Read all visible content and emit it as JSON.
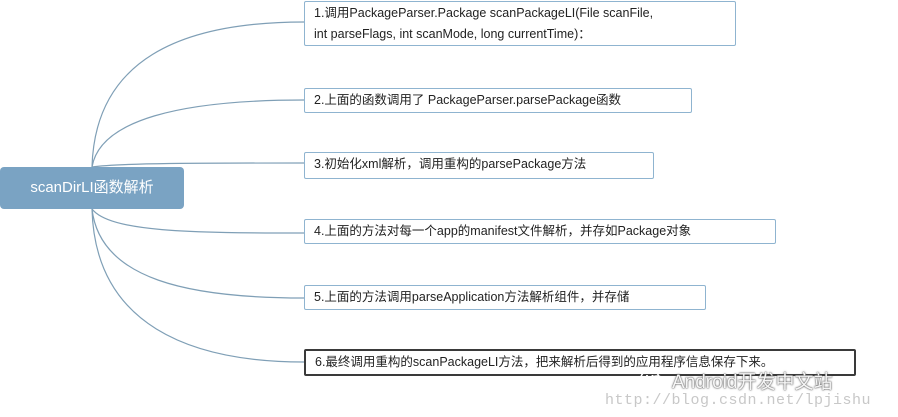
{
  "root": {
    "label": "scanDirLI函数解析"
  },
  "branches": [
    {
      "id": "1",
      "lines": [
        "1.调用PackageParser.Package scanPackageLI(File scanFile,",
        "int parseFlags, int scanMode, long currentTime)："
      ]
    },
    {
      "id": "2",
      "lines": [
        "2.上面的函数调用了 PackageParser.parsePackage函数"
      ]
    },
    {
      "id": "3",
      "lines": [
        "3.初始化xml解析，调用重构的parsePackage方法"
      ]
    },
    {
      "id": "4",
      "lines": [
        "4.上面的方法对每一个app的manifest文件解析，并存如Package对象"
      ]
    },
    {
      "id": "5",
      "lines": [
        "5.上面的方法调用parseApplication方法解析组件，并存储"
      ]
    },
    {
      "id": "6",
      "lines": [
        "6.最终调用重构的scanPackageLI方法，把来解析后得到的应用程序信息保存下来。"
      ]
    }
  ],
  "watermark": {
    "brand": "Android开发中文站",
    "url": "http://blog.csdn.net/lpjishu",
    "icon": "wechat-icon"
  },
  "colors": {
    "root_fill": "#7aa3c3",
    "node_border": "#8fb4d0",
    "connector": "#7f9fb6",
    "selected_border": "#3a3a3a"
  }
}
